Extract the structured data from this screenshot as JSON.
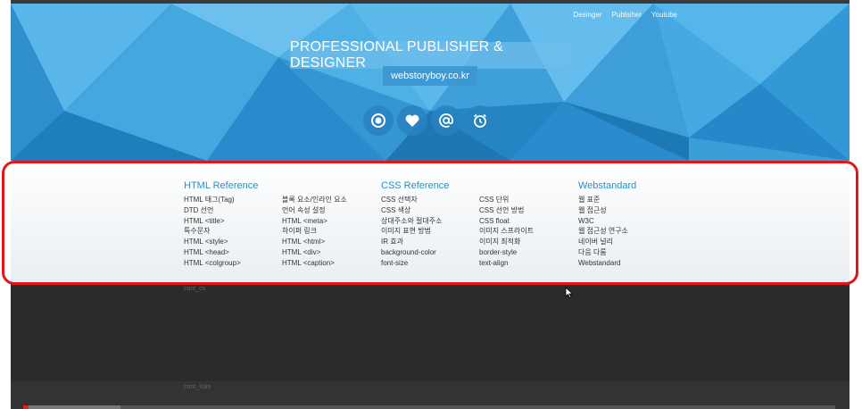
{
  "nav": {
    "items": [
      "Desinger",
      "Publisher",
      "Youtube"
    ]
  },
  "hero": {
    "title": "PROFESSIONAL PUBLISHER & DESIGNER",
    "subtitle": "webstoryboy.co.kr"
  },
  "icons": [
    "record-icon",
    "heart-icon",
    "at-icon",
    "alarm-icon"
  ],
  "colors": {
    "accent": "#2a8fc0",
    "hero": "#3a9fd8",
    "highlight": "#e0161b",
    "dark": "#2b2b2b"
  },
  "reference": {
    "html": {
      "heading": "HTML Reference",
      "col1": [
        "HTML 태그(Tag)",
        "DTD 선언",
        "HTML <title>",
        "특수문자",
        "HTML <style>",
        "HTML <head>",
        "HTML <colgroup>"
      ],
      "col2": [
        "블록 요소/인라인 요소",
        "언어 속성 설정",
        "HTML <meta>",
        "하이퍼 링크",
        "HTML <html>",
        "HTML <div>",
        "HTML <caption>"
      ]
    },
    "css": {
      "heading": "CSS Reference",
      "col1": [
        "CSS 선택자",
        "CSS 색상",
        "상대주소와 절대주소",
        "이미지 표현 방법",
        "IR 효과",
        "background-color",
        "font-size"
      ],
      "col2": [
        "CSS 단위",
        "CSS 선언 방법",
        "CSS float",
        "이미지 스프라이트",
        "이미지 최적화",
        "border-style",
        "text-align"
      ]
    },
    "web": {
      "heading": "Webstandard",
      "col1": [
        "웹 표준",
        "웹 접근성",
        "W3C",
        "웹 접근성 연구소",
        "네이버 널리",
        "다음 다룸",
        "Webstandard"
      ]
    }
  },
  "labels": {
    "cont_a": "cont_cs",
    "cont_b": "cont_Isan"
  },
  "player": {
    "progress_percent": 12
  }
}
